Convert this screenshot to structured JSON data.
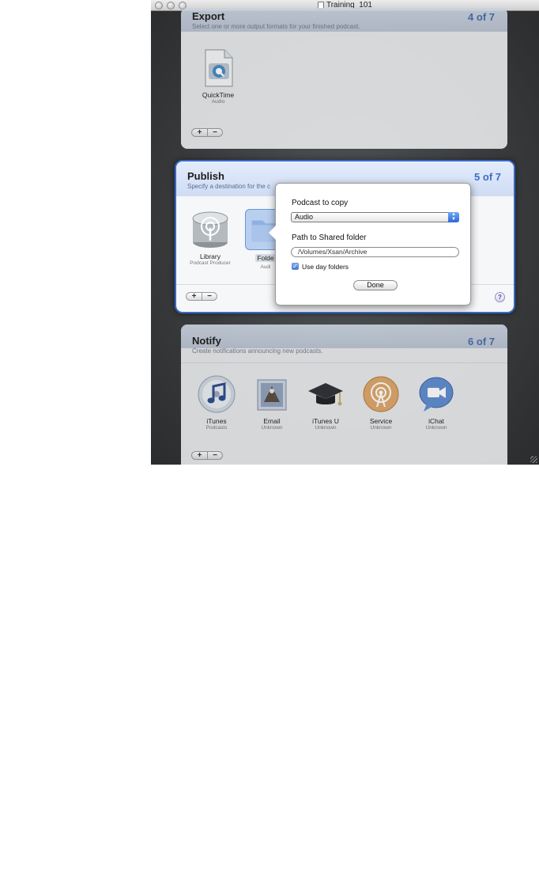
{
  "window": {
    "title": "Training_101"
  },
  "export": {
    "title": "Export",
    "subtitle": "Select one or more output formats for your finished podcast.",
    "step": "4 of 7",
    "items": [
      {
        "label": "QuickTime",
        "sublabel": "Audio",
        "icon": "quicktime-icon"
      }
    ],
    "add_label": "+",
    "remove_label": "−"
  },
  "publish": {
    "title": "Publish",
    "subtitle": "Specify a destination for the c",
    "step": "5 of 7",
    "items": [
      {
        "label": "Library",
        "sublabel": "Podcast Producer",
        "icon": "library-icon"
      },
      {
        "label": "Folde",
        "sublabel": "Audi",
        "icon": "folder-icon"
      }
    ],
    "add_label": "+",
    "remove_label": "−",
    "help_label": "?"
  },
  "popover": {
    "podcast_label": "Podcast to copy",
    "podcast_value": "Audio",
    "path_label": "Path to Shared folder",
    "path_value": "/Volumes/Xsan/Archive",
    "checkbox_label": "Use day folders",
    "checkbox_checked": true,
    "done_label": "Done"
  },
  "notify": {
    "title": "Notify",
    "subtitle": "Create notifications announcing new podcasts.",
    "step": "6 of 7",
    "items": [
      {
        "label": "iTunes",
        "sublabel": "Podcasts",
        "icon": "itunes-icon"
      },
      {
        "label": "Email",
        "sublabel": "Unknown",
        "icon": "email-icon"
      },
      {
        "label": "iTunes U",
        "sublabel": "Unknown",
        "icon": "itunes-u-icon"
      },
      {
        "label": "Service",
        "sublabel": "Unknown",
        "icon": "service-icon"
      },
      {
        "label": "iChat",
        "sublabel": "Unknown",
        "icon": "ichat-icon"
      }
    ],
    "add_label": "+",
    "remove_label": "−"
  },
  "colors": {
    "accent": "#3569c8",
    "step_text": "#3a6ec6",
    "background": "#3b3d3f"
  }
}
